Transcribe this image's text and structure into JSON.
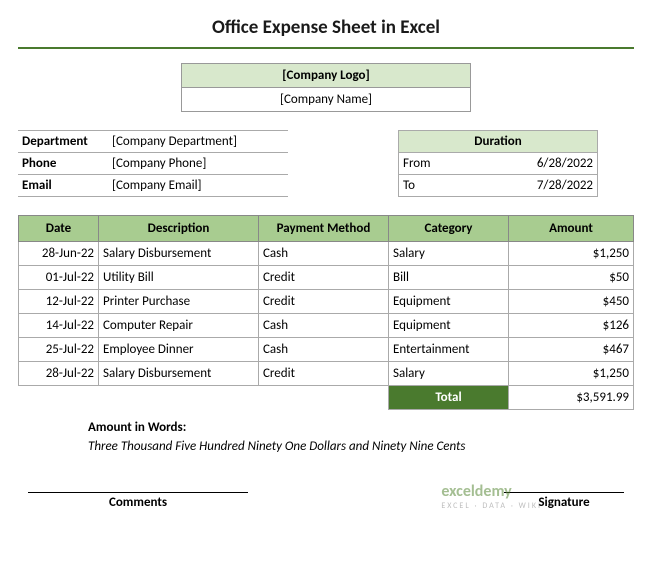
{
  "title": "Office Expense Sheet in Excel",
  "header": {
    "logo": "[Company Logo]",
    "company_name": "[Company Name]"
  },
  "company": {
    "dept_label": "Department",
    "dept_value": "[Company Department]",
    "phone_label": "Phone",
    "phone_value": "[Company Phone]",
    "email_label": "Email",
    "email_value": "[Company Email]"
  },
  "duration": {
    "heading": "Duration",
    "from_label": "From",
    "from_value": "6/28/2022",
    "to_label": "To",
    "to_value": "7/28/2022"
  },
  "columns": {
    "date": "Date",
    "desc": "Description",
    "method": "Payment Method",
    "cat": "Category",
    "amt": "Amount"
  },
  "rows": [
    {
      "date": "28-Jun-22",
      "desc": "Salary Disbursement",
      "method": "Cash",
      "cat": "Salary",
      "amt": "$1,250"
    },
    {
      "date": "01-Jul-22",
      "desc": "Utility Bill",
      "method": "Credit",
      "cat": "Bill",
      "amt": "$50"
    },
    {
      "date": "12-Jul-22",
      "desc": "Printer Purchase",
      "method": "Credit",
      "cat": "Equipment",
      "amt": "$450"
    },
    {
      "date": "14-Jul-22",
      "desc": "Computer Repair",
      "method": "Cash",
      "cat": "Equipment",
      "amt": "$126"
    },
    {
      "date": "25-Jul-22",
      "desc": "Employee Dinner",
      "method": "Cash",
      "cat": "Entertainment",
      "amt": "$467"
    },
    {
      "date": "28-Jul-22",
      "desc": "Salary Disbursement",
      "method": "Credit",
      "cat": "Salary",
      "amt": "$1,250"
    }
  ],
  "total": {
    "label": "Total",
    "value": "$3,591.99"
  },
  "words": {
    "label": "Amount in Words:",
    "text": "Three Thousand Five Hundred Ninety One Dollars and Ninety Nine Cents"
  },
  "footer": {
    "comments": "Comments",
    "signature": "Signature"
  },
  "watermark": {
    "main": "exceldemy",
    "sub": "EXCEL · DATA · WIKI"
  }
}
